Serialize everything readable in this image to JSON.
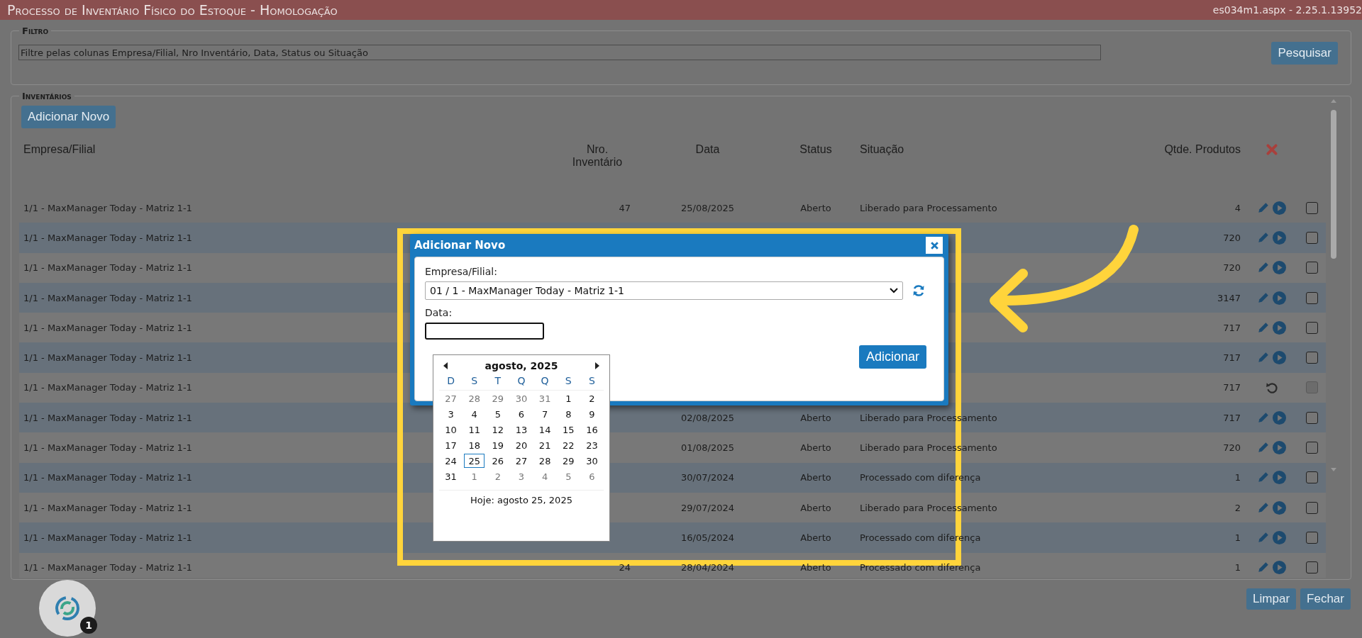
{
  "header": {
    "title": "Processo de Inventário Físico do Estoque  - Homologação",
    "page_info": "es034m1.aspx - 2.25.1.13952"
  },
  "filter": {
    "legend": "Filtro",
    "placeholder": "Filtre pelas colunas Empresa/Filial, Nro Inventário, Data, Status ou Situação",
    "button": "Pesquisar"
  },
  "inventory": {
    "legend": "Inventários",
    "add_button": "Adicionar Novo",
    "columns": [
      "Empresa/Filial",
      "Nro. Inventário",
      "Data",
      "Status",
      "Situação",
      "Qtde. Produtos"
    ],
    "rows": [
      {
        "empresa": "1/1 - MaxManager Today - Matriz 1-1",
        "nro": "47",
        "data": "25/08/2025",
        "status": "Aberto",
        "situacao": "Liberado para Processamento",
        "qtde": "4",
        "kind": "edit-run",
        "checked": false,
        "disabled": false
      },
      {
        "empresa": "1/1 - MaxManager Today - Matriz 1-1",
        "qtde": "720",
        "kind": "edit-run",
        "checked": false,
        "disabled": false
      },
      {
        "empresa": "1/1 - MaxManager Today - Matriz 1-1",
        "qtde": "720",
        "kind": "edit-run",
        "checked": false,
        "disabled": false
      },
      {
        "empresa": "1/1 - MaxManager Today - Matriz 1-1",
        "qtde": "3147",
        "kind": "edit-run",
        "checked": false,
        "disabled": false
      },
      {
        "empresa": "1/1 - MaxManager Today - Matriz 1-1",
        "qtde": "717",
        "kind": "edit-run",
        "checked": false,
        "disabled": false
      },
      {
        "empresa": "1/1 - MaxManager Today - Matriz 1-1",
        "qtde": "717",
        "kind": "edit-run",
        "checked": false,
        "disabled": false
      },
      {
        "empresa": "1/1 - MaxManager Today - Matriz 1-1",
        "qtde": "717",
        "kind": "undo",
        "checked": false,
        "disabled": true
      },
      {
        "empresa": "1/1 - MaxManager Today - Matriz 1-1",
        "data": "02/08/2025",
        "status": "Aberto",
        "situacao": "Liberado para Processamento",
        "qtde": "717",
        "kind": "edit-run",
        "checked": false,
        "disabled": false
      },
      {
        "empresa": "1/1 - MaxManager Today - Matriz 1-1",
        "data": "01/08/2025",
        "status": "Aberto",
        "situacao": "Liberado para Processamento",
        "qtde": "720",
        "kind": "edit-run",
        "checked": false,
        "disabled": false
      },
      {
        "empresa": "1/1 - MaxManager Today - Matriz 1-1",
        "data": "30/07/2024",
        "status": "Aberto",
        "situacao": "Processado com diferença",
        "qtde": "1",
        "kind": "edit-run",
        "checked": false,
        "disabled": false
      },
      {
        "empresa": "1/1 - MaxManager Today - Matriz 1-1",
        "data": "29/07/2024",
        "status": "Aberto",
        "situacao": "Liberado para Processamento",
        "qtde": "2",
        "kind": "edit-run",
        "checked": false,
        "disabled": false
      },
      {
        "empresa": "1/1 - MaxManager Today - Matriz 1-1",
        "data": "16/05/2024",
        "status": "Aberto",
        "situacao": "Processado com diferença",
        "qtde": "1",
        "kind": "edit-run",
        "checked": false,
        "disabled": false
      },
      {
        "empresa": "1/1 - MaxManager Today - Matriz 1-1",
        "nro": "24",
        "data": "28/04/2024",
        "status": "Aberto",
        "situacao": "Processado com diferença",
        "qtde": "1",
        "kind": "edit-run",
        "checked": false,
        "disabled": false
      }
    ]
  },
  "footer_buttons": [
    "Limpar",
    "Fechar"
  ],
  "chat": {
    "badge": "1"
  },
  "dialog": {
    "title": "Adicionar Novo",
    "empresa_label": "Empresa/Filial:",
    "empresa_value": "01 / 1 - MaxManager Today - Matriz 1-1",
    "date_label": "Data:",
    "date_focused": true,
    "button": "Adicionar"
  },
  "calendar": {
    "title": "agosto, 2025",
    "weekdays": [
      "D",
      "S",
      "T",
      "Q",
      "Q",
      "S",
      "S"
    ],
    "today": "Hoje: agosto 25, 2025",
    "days": [
      {
        "label": "27",
        "muted": true,
        "selected": false
      },
      {
        "label": "28",
        "muted": true,
        "selected": false
      },
      {
        "label": "29",
        "muted": true,
        "selected": false
      },
      {
        "label": "30",
        "muted": true,
        "selected": false
      },
      {
        "label": "31",
        "muted": true,
        "selected": false
      },
      {
        "label": "1",
        "muted": false,
        "selected": false
      },
      {
        "label": "2",
        "muted": false,
        "selected": false
      },
      {
        "label": "3",
        "muted": false,
        "selected": false
      },
      {
        "label": "4",
        "muted": false,
        "selected": false
      },
      {
        "label": "5",
        "muted": false,
        "selected": false
      },
      {
        "label": "6",
        "muted": false,
        "selected": false
      },
      {
        "label": "7",
        "muted": false,
        "selected": false
      },
      {
        "label": "8",
        "muted": false,
        "selected": false
      },
      {
        "label": "9",
        "muted": false,
        "selected": false
      },
      {
        "label": "10",
        "muted": false,
        "selected": false
      },
      {
        "label": "11",
        "muted": false,
        "selected": false
      },
      {
        "label": "12",
        "muted": false,
        "selected": false
      },
      {
        "label": "13",
        "muted": false,
        "selected": false
      },
      {
        "label": "14",
        "muted": false,
        "selected": false
      },
      {
        "label": "15",
        "muted": false,
        "selected": false
      },
      {
        "label": "16",
        "muted": false,
        "selected": false
      },
      {
        "label": "17",
        "muted": false,
        "selected": false
      },
      {
        "label": "18",
        "muted": false,
        "selected": false
      },
      {
        "label": "19",
        "muted": false,
        "selected": false
      },
      {
        "label": "20",
        "muted": false,
        "selected": false
      },
      {
        "label": "21",
        "muted": false,
        "selected": false
      },
      {
        "label": "22",
        "muted": false,
        "selected": false
      },
      {
        "label": "23",
        "muted": false,
        "selected": false
      },
      {
        "label": "24",
        "muted": false,
        "selected": false
      },
      {
        "label": "25",
        "muted": false,
        "selected": true
      },
      {
        "label": "26",
        "muted": false,
        "selected": false
      },
      {
        "label": "27",
        "muted": false,
        "selected": false
      },
      {
        "label": "28",
        "muted": false,
        "selected": false
      },
      {
        "label": "29",
        "muted": false,
        "selected": false
      },
      {
        "label": "30",
        "muted": false,
        "selected": false
      },
      {
        "label": "31",
        "muted": false,
        "selected": false
      },
      {
        "label": "1",
        "muted": true,
        "selected": false
      },
      {
        "label": "2",
        "muted": true,
        "selected": false
      },
      {
        "label": "3",
        "muted": true,
        "selected": false
      },
      {
        "label": "4",
        "muted": true,
        "selected": false
      },
      {
        "label": "5",
        "muted": true,
        "selected": false
      },
      {
        "label": "6",
        "muted": true,
        "selected": false
      }
    ]
  }
}
